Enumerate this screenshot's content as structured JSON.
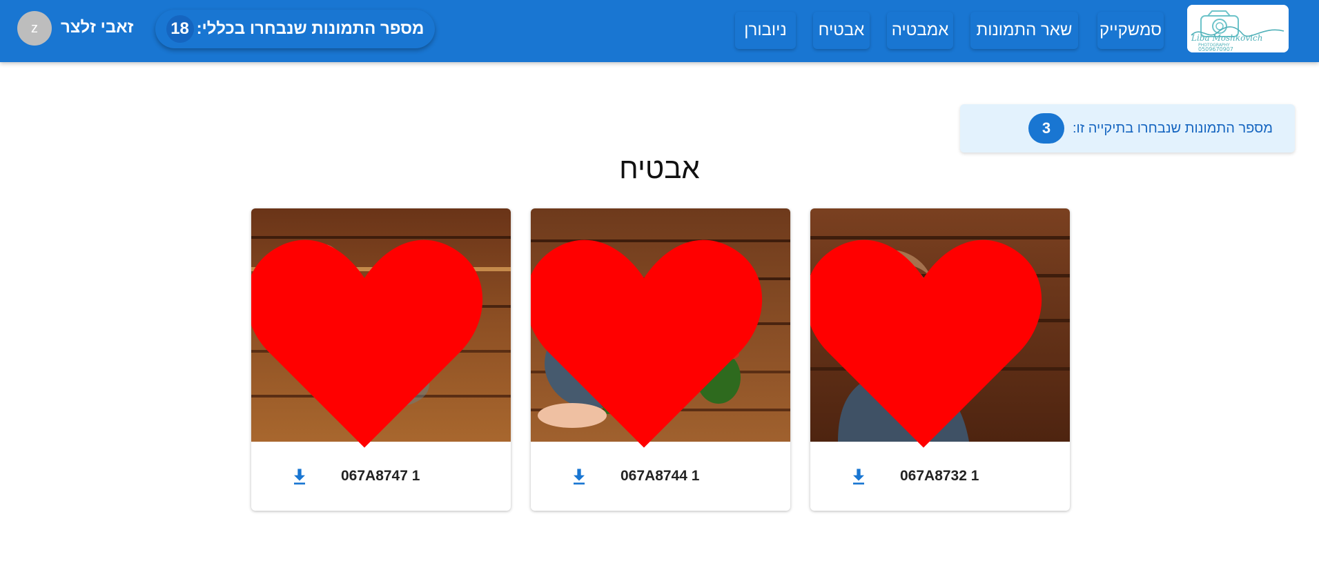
{
  "nav": {
    "logo": {
      "script": "Liba Moshkovich",
      "tagline": "PHOTOGRAPHY",
      "phone": "0509670907"
    },
    "items": [
      {
        "label": "סמשקייק"
      },
      {
        "label": "שאר  התמונות"
      },
      {
        "label": "אמבטיה"
      },
      {
        "label": "אבטיח"
      },
      {
        "label": "ניובורן"
      }
    ],
    "total_label": "מספר התמונות שנבחרו בכללי:",
    "total_count": "18",
    "user_name": "זאבי זלצר",
    "avatar_letter": "z"
  },
  "album_info": {
    "label": "מספר התמונות שנבחרו בתיקייה זו:",
    "count": "3"
  },
  "album_title": "אבטיח",
  "photos": [
    {
      "file": "067A8732 1",
      "favorited": true
    },
    {
      "file": "067A8744 1",
      "favorited": true
    },
    {
      "file": "067A8747 1",
      "favorited": true
    }
  ],
  "colors": {
    "primary": "#1976d2",
    "primary_dark": "#1565c0",
    "info_bg": "#e3f2fd",
    "heart": "#ff0000"
  },
  "icons": {
    "favorite": "heart-icon",
    "download": "download-icon"
  }
}
